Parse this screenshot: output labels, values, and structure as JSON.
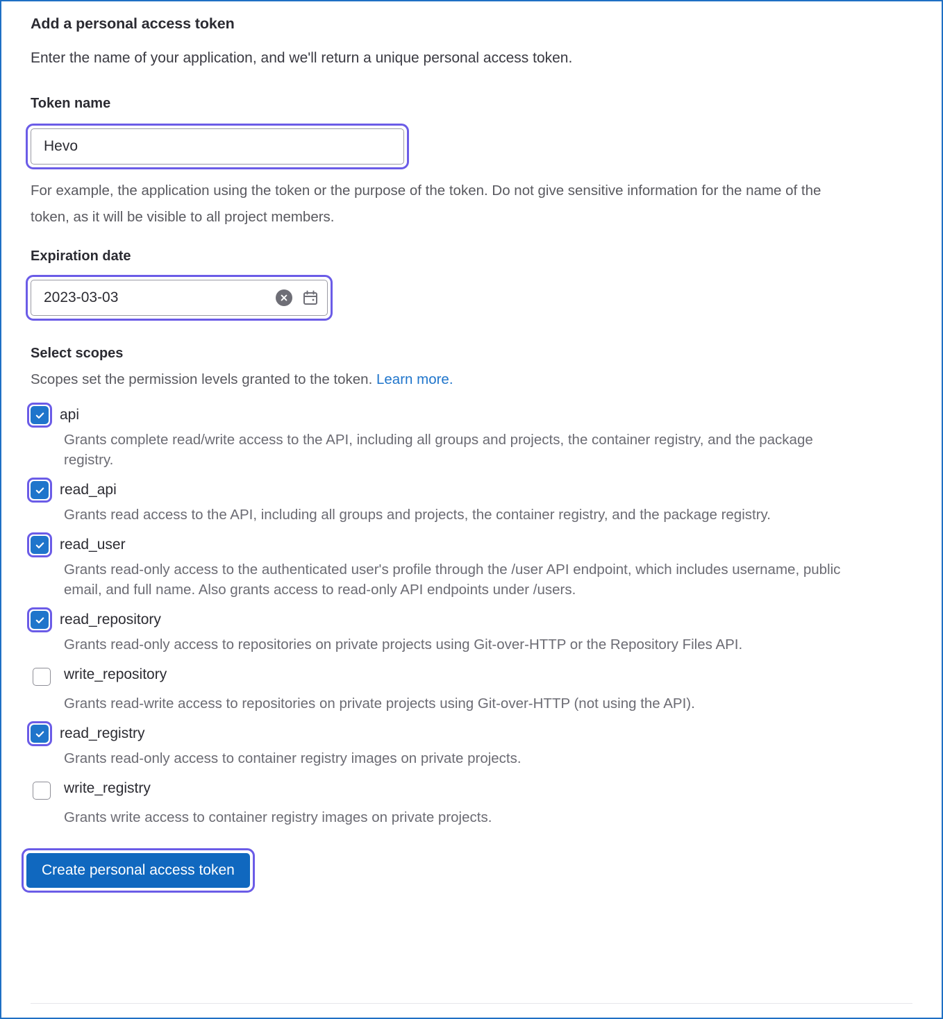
{
  "form": {
    "title": "Add a personal access token",
    "subtitle": "Enter the name of your application, and we'll return a unique personal access token."
  },
  "token_name": {
    "label": "Token name",
    "value": "Hevo",
    "placeholder": "",
    "help": "For example, the application using the token or the purpose of the token. Do not give sensitive information for the name of the token, as it will be visible to all project members."
  },
  "expiration": {
    "label": "Expiration date",
    "value": "2023-03-03",
    "clear_icon": "clear-circle-icon",
    "calendar_icon": "calendar-icon"
  },
  "scopes": {
    "label": "Select scopes",
    "description": "Scopes set the permission levels granted to the token.",
    "learn_more": "Learn more.",
    "items": [
      {
        "name": "api",
        "checked": true,
        "description": "Grants complete read/write access to the API, including all groups and projects, the container registry, and the package registry."
      },
      {
        "name": "read_api",
        "checked": true,
        "description": "Grants read access to the API, including all groups and projects, the container registry, and the package registry."
      },
      {
        "name": "read_user",
        "checked": true,
        "description": "Grants read-only access to the authenticated user's profile through the /user API endpoint, which includes username, public email, and full name. Also grants access to read-only API endpoints under /users."
      },
      {
        "name": "read_repository",
        "checked": true,
        "description": "Grants read-only access to repositories on private projects using Git-over-HTTP or the Repository Files API."
      },
      {
        "name": "write_repository",
        "checked": false,
        "description": "Grants read-write access to repositories on private projects using Git-over-HTTP (not using the API)."
      },
      {
        "name": "read_registry",
        "checked": true,
        "description": "Grants read-only access to container registry images on private projects."
      },
      {
        "name": "write_registry",
        "checked": false,
        "description": "Grants write access to container registry images on private projects."
      }
    ]
  },
  "submit": {
    "label": "Create personal access token"
  },
  "colors": {
    "accent_blue": "#1f75cb",
    "button_blue": "#1068bf",
    "highlight_purple": "#6b5ce7",
    "frame_blue": "#1f6fc4",
    "muted_text": "#6b6b73"
  }
}
